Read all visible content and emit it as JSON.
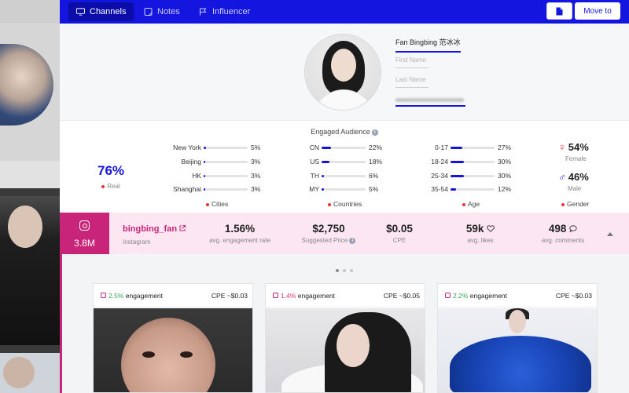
{
  "topbar": {
    "tabs": [
      {
        "label": "Channels",
        "icon": "monitor-icon",
        "active": true
      },
      {
        "label": "Notes",
        "icon": "note-icon",
        "active": false
      },
      {
        "label": "Influencer",
        "icon": "flag-icon",
        "active": false
      }
    ],
    "file_icon": "file-icon",
    "move_label": "Move to",
    "accent_color": "#1515e0"
  },
  "profile": {
    "name_value": "Fan Bingbing 范冰冰",
    "first_name_placeholder": "First Name",
    "last_name_placeholder": "Last Name"
  },
  "audience": {
    "title": "Engaged Audience",
    "real": {
      "pct": "76%",
      "label": "Real"
    },
    "cities": {
      "label": "Cities",
      "items": [
        {
          "name": "New York",
          "value": "5%",
          "pct": 5
        },
        {
          "name": "Beijing",
          "value": "3%",
          "pct": 3
        },
        {
          "name": "HK",
          "value": "3%",
          "pct": 3
        },
        {
          "name": "Shanghai",
          "value": "3%",
          "pct": 3
        }
      ]
    },
    "countries": {
      "label": "Countries",
      "items": [
        {
          "name": "CN",
          "value": "22%",
          "pct": 22
        },
        {
          "name": "US",
          "value": "18%",
          "pct": 18
        },
        {
          "name": "TH",
          "value": "6%",
          "pct": 6
        },
        {
          "name": "MY",
          "value": "5%",
          "pct": 5
        }
      ]
    },
    "age": {
      "label": "Age",
      "items": [
        {
          "name": "0-17",
          "value": "27%",
          "pct": 27
        },
        {
          "name": "18-24",
          "value": "30%",
          "pct": 30
        },
        {
          "name": "25-34",
          "value": "30%",
          "pct": 30
        },
        {
          "name": "35-54",
          "value": "12%",
          "pct": 12
        }
      ]
    },
    "gender": {
      "label": "Gender",
      "female": {
        "symbol": "♀",
        "value": "54%",
        "label": "Female"
      },
      "male": {
        "symbol": "♂",
        "value": "46%",
        "label": "Male"
      }
    }
  },
  "channel": {
    "platform_icon": "instagram-icon",
    "followers": "3.8M",
    "handle": "bingbing_fan",
    "platform": "Instagram",
    "color": "#c8257a",
    "metrics": [
      {
        "value": "1.56%",
        "label": "avg. engagement rate"
      },
      {
        "value": "$2,750",
        "label": "Suggested Price"
      },
      {
        "value": "$0.05",
        "label": "CPE"
      },
      {
        "value": "59k",
        "label": "avg. likes"
      },
      {
        "value": "498",
        "label": "avg. comments"
      }
    ]
  },
  "posts": [
    {
      "engagement_pct": "2.5%",
      "engagement_label": "engagement",
      "cpe": "CPE ~$0.03"
    },
    {
      "engagement_pct": "1.4%",
      "engagement_label": "engagement",
      "cpe": "CPE ~$0.05"
    },
    {
      "engagement_pct": "2.2%",
      "engagement_label": "engagement",
      "cpe": "CPE ~$0.03"
    }
  ]
}
